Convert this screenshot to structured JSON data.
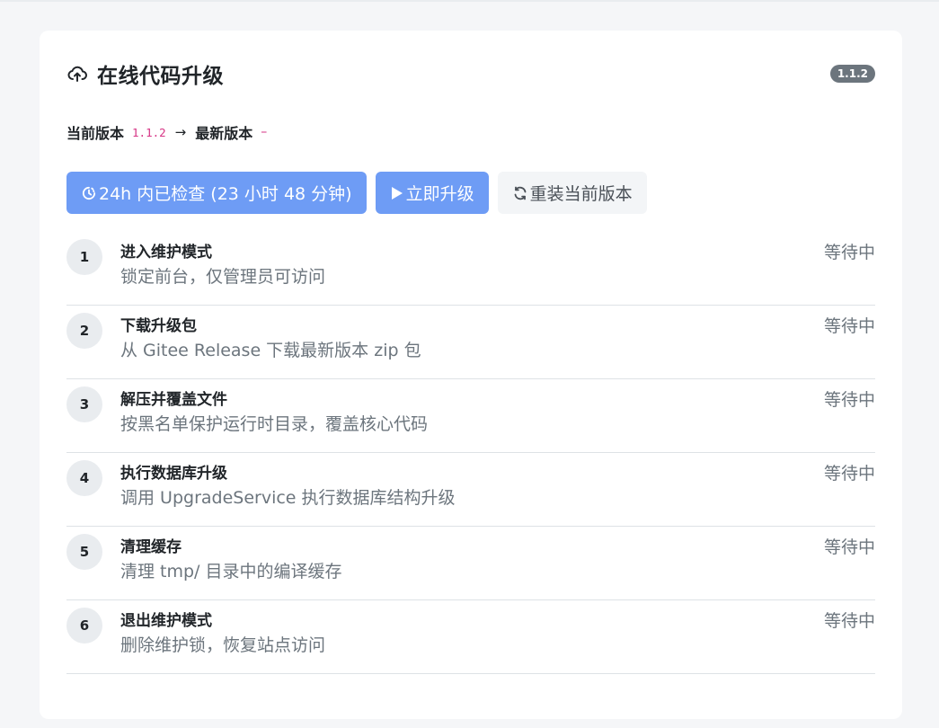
{
  "header": {
    "title": "在线代码升级",
    "icon": "cloud-upload-icon",
    "version_badge": "1.1.2"
  },
  "versions": {
    "current_label": "当前版本",
    "current_value": "1.1.2",
    "arrow": "→",
    "latest_label": "最新版本",
    "latest_value": "–"
  },
  "actions": {
    "check_label": "24h 内已检查 (23 小时 48 分钟)",
    "check_icon": "clock-icon",
    "upgrade_label": "立即升级",
    "upgrade_icon": "play-icon",
    "reinstall_label": "重装当前版本",
    "reinstall_icon": "refresh-icon"
  },
  "steps": [
    {
      "num": "1",
      "name": "进入维护模式",
      "desc": "锁定前台，仅管理员可访问",
      "status": "等待中"
    },
    {
      "num": "2",
      "name": "下载升级包",
      "desc": "从 Gitee Release 下载最新版本 zip 包",
      "status": "等待中"
    },
    {
      "num": "3",
      "name": "解压并覆盖文件",
      "desc": "按黑名单保护运行时目录，覆盖核心代码",
      "status": "等待中"
    },
    {
      "num": "4",
      "name": "执行数据库升级",
      "desc": "调用 UpgradeService 执行数据库结构升级",
      "status": "等待中"
    },
    {
      "num": "5",
      "name": "清理缓存",
      "desc": "清理 tmp/ 目录中的编译缓存",
      "status": "等待中"
    },
    {
      "num": "6",
      "name": "退出维护模式",
      "desc": "删除维护锁，恢复站点访问",
      "status": "等待中"
    }
  ]
}
